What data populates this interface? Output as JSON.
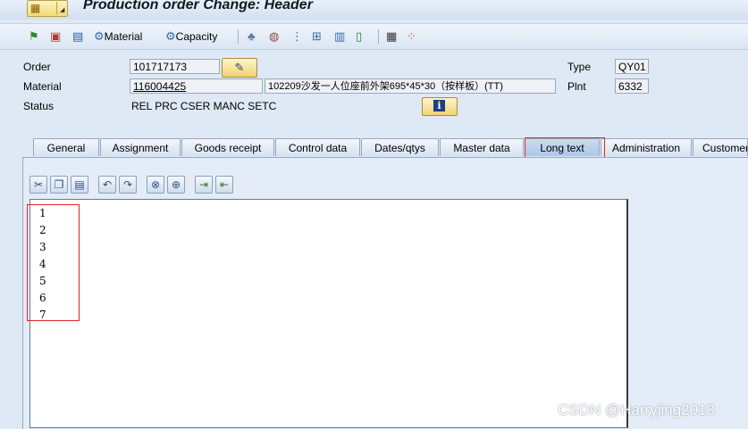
{
  "window": {
    "title": "Production order Change: Header"
  },
  "toolbar": {
    "material_label": "Material",
    "capacity_label": "Capacity"
  },
  "header": {
    "order_label": "Order",
    "order_value": "101717173",
    "material_label": "Material",
    "material_value": "116004425",
    "material_desc": "102209沙发一人位座前外架695*45*30（按样板）(TT)",
    "status_label": "Status",
    "status_value": "REL  PRC  CSER MANC SETC",
    "type_label": "Type",
    "type_value": "QY01",
    "plant_label": "Plnt",
    "plant_value": "6332"
  },
  "tabs": [
    {
      "label": "General"
    },
    {
      "label": "Assignment"
    },
    {
      "label": "Goods receipt"
    },
    {
      "label": "Control data"
    },
    {
      "label": "Dates/qtys"
    },
    {
      "label": "Master data"
    },
    {
      "label": "Long text"
    },
    {
      "label": "Administration"
    },
    {
      "label": "Customer"
    }
  ],
  "active_tab": "Long text",
  "editor": {
    "lines": [
      "1",
      "2",
      "3",
      "4",
      "5",
      "6",
      "7"
    ]
  },
  "watermark": "CSDN @Harryjing2018",
  "colors": {
    "highlight_box": "#e3242b",
    "background": "#dfe9f5"
  }
}
